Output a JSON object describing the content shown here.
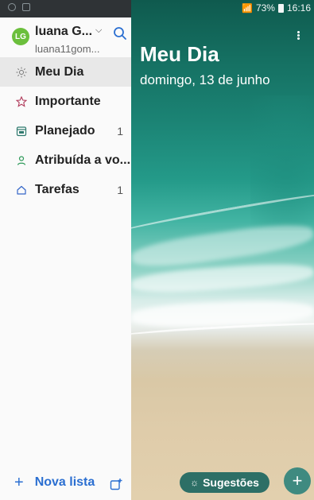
{
  "status_bar": {
    "battery_percent": "73%",
    "time": "16:16"
  },
  "account": {
    "initials": "LG",
    "name": "luana G...",
    "email": "luana11gom..."
  },
  "nav": {
    "items": [
      {
        "label": "Meu Dia",
        "icon": "sun-icon",
        "count": "",
        "active": true
      },
      {
        "label": "Importante",
        "icon": "star-icon",
        "count": ""
      },
      {
        "label": "Planejado",
        "icon": "calendar-icon",
        "count": "1"
      },
      {
        "label": "Atribuída a vo...",
        "icon": "person-icon",
        "count": ""
      },
      {
        "label": "Tarefas",
        "icon": "home-icon",
        "count": "1"
      }
    ]
  },
  "sidebar_footer": {
    "new_list_label": "Nova lista"
  },
  "main": {
    "title": "Meu Dia",
    "subtitle": "domingo, 13 de junho",
    "suggestions_label": "Sugestões"
  },
  "colors": {
    "accent_blue": "#2b6fd1",
    "avatar_green": "#6bbf3c",
    "suggestions_bg": "#2d6f66",
    "fab_bg": "#3f8a80"
  }
}
